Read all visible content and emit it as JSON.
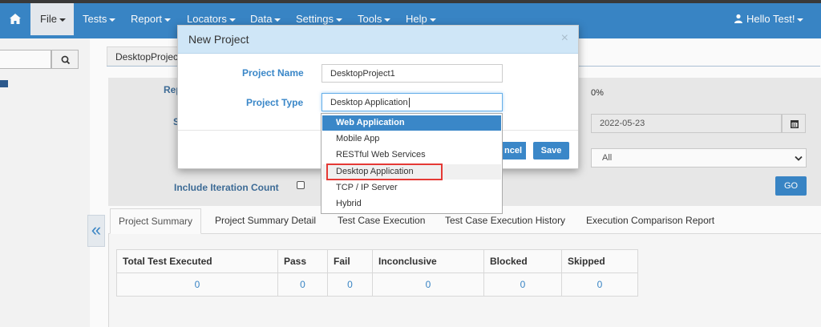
{
  "navbar": {
    "items": [
      {
        "label": "File",
        "active": true
      },
      {
        "label": "Tests"
      },
      {
        "label": "Report"
      },
      {
        "label": "Locators"
      },
      {
        "label": "Data"
      },
      {
        "label": "Settings"
      },
      {
        "label": "Tools"
      },
      {
        "label": "Help"
      }
    ],
    "user_label": "Hello Test!",
    "accent": "#3a87c8"
  },
  "breadcrumb": "DesktopProject",
  "filters": {
    "label_1": "Rep",
    "label_2": "S",
    "include_iteration_label": "Include Iteration Count",
    "percent": "0%",
    "date": "2022-05-23",
    "select_value": "All",
    "go_label": "GO"
  },
  "result_tabs": [
    "Project Summary",
    "Project Summary Detail",
    "Test Case Execution",
    "Test Case Execution History",
    "Execution Comparison Report"
  ],
  "summary_table": {
    "headers": [
      "Total Test Executed",
      "Pass",
      "Fail",
      "Inconclusive",
      "Blocked",
      "Skipped"
    ],
    "row": [
      "0",
      "0",
      "0",
      "0",
      "0",
      "0"
    ]
  },
  "modal": {
    "title": "New Project",
    "close_glyph": "×",
    "project_name_label": "Project Name",
    "project_name_value": "DesktopProject1",
    "project_type_label": "Project Type",
    "project_type_value": "Desktop Application",
    "cancel_label": "ncel",
    "save_label": "Save"
  },
  "project_type_options": [
    {
      "label": "Web Application",
      "state": "selected"
    },
    {
      "label": "Mobile App"
    },
    {
      "label": "RESTful Web Services"
    },
    {
      "label": "Desktop Application",
      "state": "hover"
    },
    {
      "label": "TCP / IP Server"
    },
    {
      "label": "Hybrid"
    }
  ],
  "icons": {
    "home": "home-icon",
    "search": "search-icon",
    "user": "user-icon",
    "calendar": "calendar-icon",
    "collapse": "double-chevron-left-icon"
  },
  "collapse_glyph": "«"
}
